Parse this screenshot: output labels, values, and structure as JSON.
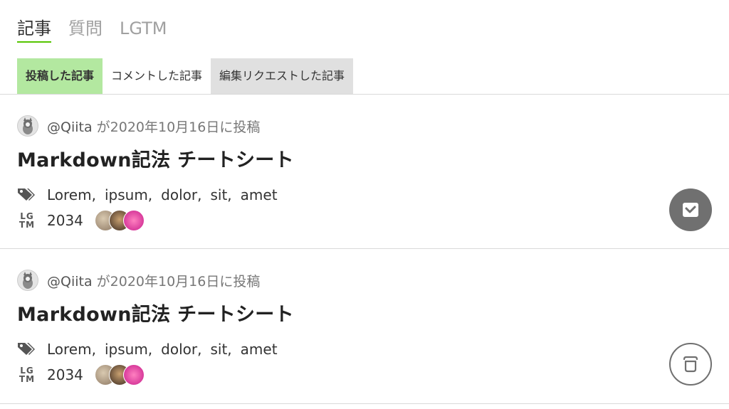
{
  "main_tabs": [
    {
      "label": "記事"
    },
    {
      "label": "質問"
    },
    {
      "label": "LGTM"
    }
  ],
  "sub_tabs": [
    {
      "label": "投稿した記事"
    },
    {
      "label": "コメントした記事"
    },
    {
      "label": "編集リクエストした記事"
    }
  ],
  "articles": [
    {
      "author": "@Qiita",
      "posted": "が2020年10月16日に投稿",
      "title": "Markdown記法 チートシート",
      "tags": [
        "Lorem,",
        "ipsum,",
        "dolor,",
        "sit,",
        "amet"
      ],
      "lgtm_label": "LGTM",
      "lgtm_count": "2034",
      "stocked": true,
      "stock_icon": "check-tray-icon"
    },
    {
      "author": "@Qiita",
      "posted": "が2020年10月16日に投稿",
      "title": "Markdown記法 チートシート",
      "tags": [
        "Lorem,",
        "ipsum,",
        "dolor,",
        "sit,",
        "amet"
      ],
      "lgtm_label": "LGTM",
      "lgtm_count": "2034",
      "stocked": false,
      "stock_icon": "empty-tray-icon"
    }
  ],
  "colors": {
    "accent_green": "#55c500",
    "active_subtab": "#b3e8a0",
    "disabled_subtab": "#e0e0e0",
    "stock_gray": "#707070"
  }
}
